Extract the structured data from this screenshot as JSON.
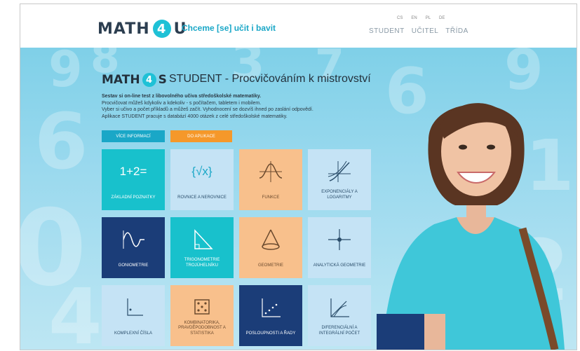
{
  "header": {
    "logo_left": "MATH",
    "logo_four": "4",
    "logo_right": "U",
    "slogan": "Chceme [se] učit i bavit",
    "languages": [
      "CS",
      "EN",
      "PL",
      "DE"
    ],
    "nav": [
      "STUDENT",
      "UČITEL",
      "TŘÍDA"
    ]
  },
  "panel": {
    "logo_left": "MATH",
    "logo_four": "4",
    "logo_right": "S",
    "title": "STUDENT - Procvičováním k mistrovství",
    "desc_bold": "Sestav si on-line test z libovolného učiva středoškolské matematiky.",
    "desc_lines": [
      "Procvičovat můžeš kdykoliv a kdekoliv - s počítačem, tabletem i mobilem.",
      "Vyber si učivo a počet příkladů a můžeš začít. Vyhodnocení se dozvíš ihned po zaslání odpovědí.",
      "Aplikace STUDENT pracuje s databází 4000 otázek z celé středoškolské matematiky."
    ],
    "btn_info": "Více informací",
    "btn_app": "Do aplikace"
  },
  "tiles": [
    {
      "label": "Základní poznatky",
      "icon": "1+2=",
      "icon_name": "equation-icon",
      "color": "#18c1cc"
    },
    {
      "label": "Rovnice a nerovnice",
      "icon": "{√x}",
      "icon_name": "braces-root-icon",
      "color": "#c5e3f5"
    },
    {
      "label": "Funkce",
      "icon": "",
      "icon_name": "function-graph-icon",
      "color": "#f8c08c"
    },
    {
      "label": "Exponenciály a logaritmy",
      "icon": "",
      "icon_name": "exponential-graph-icon",
      "color": "#c5e3f5"
    },
    {
      "label": "Goniometrie",
      "icon": "",
      "icon_name": "sine-wave-icon",
      "color": "#1b3d78"
    },
    {
      "label": "Trigonometrie trojúhelníku",
      "icon": "",
      "icon_name": "triangle-icon",
      "color": "#18c1cc"
    },
    {
      "label": "Geometrie",
      "icon": "",
      "icon_name": "cone-icon",
      "color": "#f8c08c"
    },
    {
      "label": "Analytická geometrie",
      "icon": "",
      "icon_name": "axes-point-icon",
      "color": "#c5e3f5"
    },
    {
      "label": "Komplexní čísla",
      "icon": "",
      "icon_name": "complex-plane-icon",
      "color": "#c5e3f5"
    },
    {
      "label": "Kombinatorika, pravděpodobnost a statistika",
      "icon": "",
      "icon_name": "dice-icon",
      "color": "#f8c08c"
    },
    {
      "label": "Posloupnosti a řady",
      "icon": "",
      "icon_name": "sequence-dots-icon",
      "color": "#1b3d78"
    },
    {
      "label": "Diferenciální a integrální počet",
      "icon": "",
      "icon_name": "tangent-line-icon",
      "color": "#c5e3f5"
    }
  ]
}
